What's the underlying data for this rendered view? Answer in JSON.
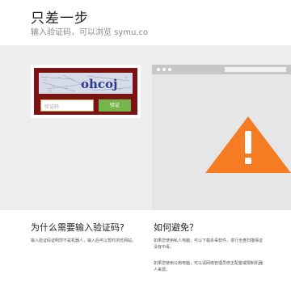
{
  "header": {
    "title": "只差一步",
    "subtitle": "输入验证码，可以浏览 symu.co"
  },
  "captcha": {
    "image_text": "ohcoj",
    "input_placeholder": "验证码",
    "submit_label": "验证"
  },
  "warning_icon": "warning-triangle-icon",
  "why": {
    "title": "为什么需要输入验证码?",
    "text": "输入验证码证明您不是机器人，输入后可以暂时浏览网站。"
  },
  "how": {
    "title": "如何避免？",
    "text1": "如果您使用私人电脑，可以下载杀毒软件，进行全盘扫描保证没有中毒。",
    "text2": "如果您使用公用电脑，可以请网络管理员修正配置或限制机器人来源。"
  },
  "colors": {
    "accent_orange": "#f57c22",
    "captcha_frame": "#7a1414",
    "submit_green": "#75b64a"
  }
}
